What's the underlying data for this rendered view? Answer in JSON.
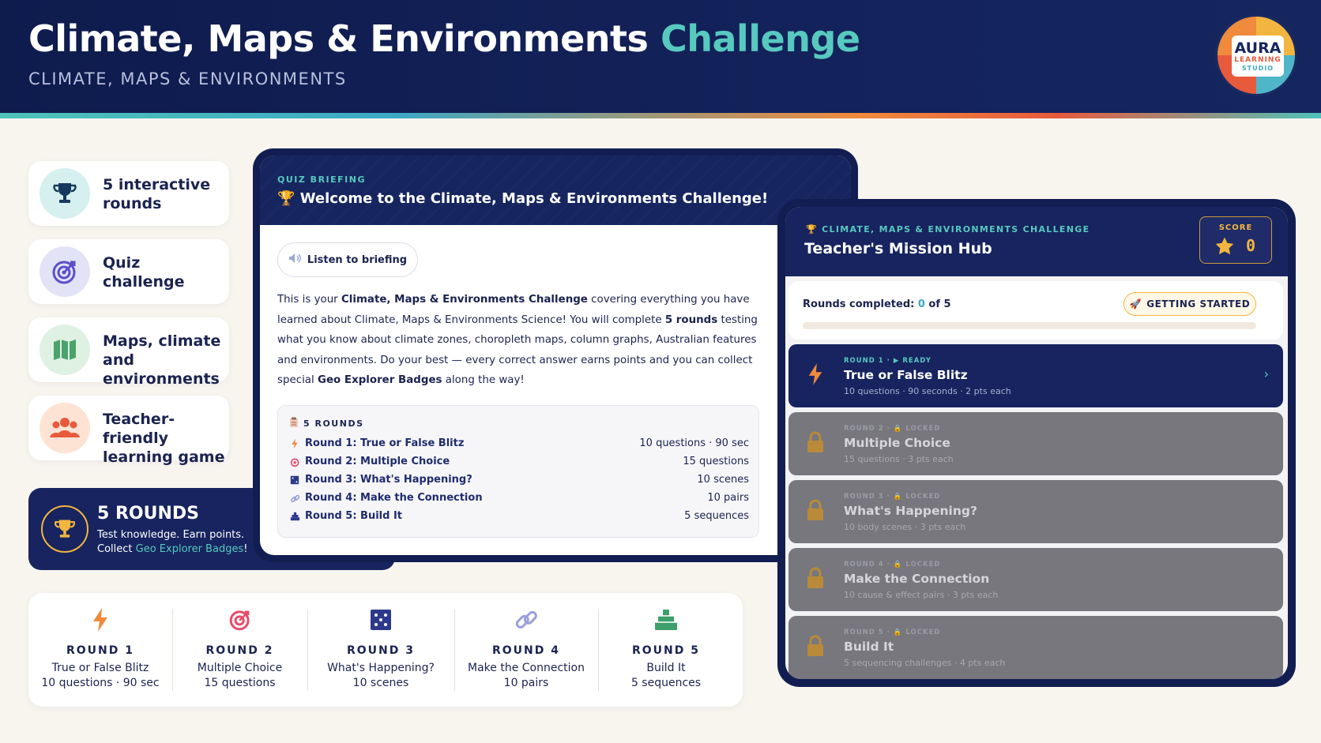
{
  "header": {
    "title_main": "Climate, Maps & Environments",
    "title_accent": "Challenge",
    "subtitle": "CLIMATE, MAPS & ENVIRONMENTS",
    "logo": {
      "line1": "AURA",
      "line2": "LEARNING",
      "line3": "STUDIO"
    }
  },
  "features": [
    {
      "icon": "trophy-icon",
      "label": "5 interactive rounds",
      "color": "#d5f0ee"
    },
    {
      "icon": "target-icon",
      "label": "Quiz challenge",
      "color": "#e3e3f7"
    },
    {
      "icon": "map-icon",
      "label": "Maps, climate and environments",
      "color": "#dff1e3"
    },
    {
      "icon": "people-icon",
      "label": "Teacher-friendly learning game",
      "color": "#fde3d4"
    }
  ],
  "rounds_banner": {
    "title": "5 ROUNDS",
    "line1": "Test knowledge. Earn points.",
    "line2_prefix": "Collect ",
    "line2_highlight": "Geo Explorer Badges",
    "line2_suffix": "!"
  },
  "strip": [
    {
      "icon": "lightning-icon",
      "label": "ROUND 1",
      "name": "True or False Blitz",
      "detail": "10 questions · 90 sec"
    },
    {
      "icon": "target-icon",
      "label": "ROUND 2",
      "name": "Multiple Choice",
      "detail": "15 questions"
    },
    {
      "icon": "scene-icon",
      "label": "ROUND 3",
      "name": "What's Happening?",
      "detail": "10 scenes"
    },
    {
      "icon": "link-icon",
      "label": "ROUND 4",
      "name": "Make the Connection",
      "detail": "10 pairs"
    },
    {
      "icon": "build-icon",
      "label": "ROUND 5",
      "name": "Build It",
      "detail": "5 sequences"
    }
  ],
  "briefing": {
    "kicker": "QUIZ BRIEFING",
    "title": "Welcome to the Climate, Maps & Environments Challenge!",
    "listen_label": "Listen to briefing",
    "para": {
      "p1": "This is your ",
      "b1": "Climate, Maps & Environments Challenge",
      "p2": " covering everything you have learned about Climate, Maps & Environments Science! You will complete ",
      "b2": "5 rounds",
      "p3": " testing what you know about climate zones, choropleth maps, column graphs, Australian features and environments. Do your best — every correct answer earns points and you can collect special ",
      "b3": "Geo Explorer Badges",
      "p4": " along the way!"
    },
    "list_heading": "5 ROUNDS",
    "list": [
      {
        "icon": "lightning-icon",
        "name": "Round 1: True or False Blitz",
        "detail": "10 questions · 90 sec"
      },
      {
        "icon": "target-icon",
        "name": "Round 2: Multiple Choice",
        "detail": "15 questions"
      },
      {
        "icon": "scene-icon",
        "name": "Round 3: What's Happening?",
        "detail": "10 scenes"
      },
      {
        "icon": "link-icon",
        "name": "Round 4: Make the Connection",
        "detail": "10 pairs"
      },
      {
        "icon": "build-icon",
        "name": "Round 5: Build It",
        "detail": "5 sequences"
      }
    ]
  },
  "hub": {
    "kicker": "CLIMATE, MAPS & ENVIRONMENTS CHALLENGE",
    "title": "Teacher's Mission Hub",
    "score_label": "SCORE",
    "score_value": "0",
    "progress_prefix": "Rounds completed: ",
    "progress_done": "0",
    "progress_suffix": " of 5",
    "progress_fraction": 0,
    "badge_label": "GETTING STARTED",
    "rounds": [
      {
        "state": "ready",
        "tag": "ROUND 1 · ▶ READY",
        "title": "True or False Blitz",
        "detail": "10 questions · 90 seconds · 2 pts each"
      },
      {
        "state": "locked",
        "tag": "ROUND 2 · 🔒 LOCKED",
        "title": "Multiple Choice",
        "detail": "15 questions · 3 pts each"
      },
      {
        "state": "locked",
        "tag": "ROUND 3 · 🔒 LOCKED",
        "title": "What's Happening?",
        "detail": "10 body scenes · 3 pts each"
      },
      {
        "state": "locked",
        "tag": "ROUND 4 · 🔒 LOCKED",
        "title": "Make the Connection",
        "detail": "10 cause & effect pairs · 3 pts each"
      },
      {
        "state": "locked",
        "tag": "ROUND 5 · 🔒 LOCKED",
        "title": "Build It",
        "detail": "5 sequencing challenges · 4 pts each"
      }
    ]
  }
}
